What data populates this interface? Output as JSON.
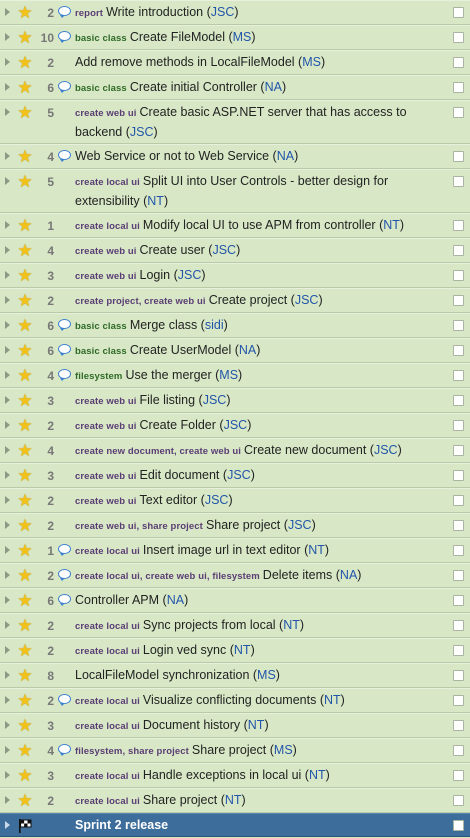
{
  "stories": [
    {
      "points": "2",
      "comment": true,
      "tags": "report",
      "tag_color": "purple",
      "title": "Write introduction",
      "owner": "JSC"
    },
    {
      "points": "10",
      "comment": true,
      "tags": "basic class",
      "tag_color": "green",
      "title": "Create FileModel",
      "owner": "MS"
    },
    {
      "points": "2",
      "comment": false,
      "tags": "",
      "tag_color": "",
      "title": "Add remove methods in LocalFileModel",
      "owner": "MS"
    },
    {
      "points": "6",
      "comment": true,
      "tags": "basic class",
      "tag_color": "green",
      "title": "Create initial Controller",
      "owner": "NA"
    },
    {
      "points": "5",
      "comment": false,
      "tags": "create web ui",
      "tag_color": "purple",
      "title": "Create basic ASP.NET server that has access to backend",
      "owner": "JSC",
      "tall": true
    },
    {
      "points": "4",
      "comment": true,
      "tags": "",
      "tag_color": "",
      "title": "Web Service or not to Web Service",
      "owner": "NA"
    },
    {
      "points": "5",
      "comment": false,
      "tags": "create local ui",
      "tag_color": "purple",
      "title": "Split UI into User Controls - better design for extensibility",
      "owner": "NT",
      "tall": true
    },
    {
      "points": "1",
      "comment": false,
      "tags": "create local ui",
      "tag_color": "purple",
      "title": "Modify local UI to use APM from controller",
      "owner": "NT"
    },
    {
      "points": "4",
      "comment": false,
      "tags": "create web ui",
      "tag_color": "purple",
      "title": "Create user",
      "owner": "JSC"
    },
    {
      "points": "3",
      "comment": false,
      "tags": "create web ui",
      "tag_color": "purple",
      "title": "Login",
      "owner": "JSC"
    },
    {
      "points": "2",
      "comment": false,
      "tags": "create project, create web ui",
      "tag_color": "purple",
      "title": "Create project",
      "owner": "JSC"
    },
    {
      "points": "6",
      "comment": true,
      "tags": "basic class",
      "tag_color": "green",
      "title": "Merge class",
      "owner": "sidi"
    },
    {
      "points": "6",
      "comment": true,
      "tags": "basic class",
      "tag_color": "green",
      "title": "Create UserModel",
      "owner": "NA"
    },
    {
      "points": "4",
      "comment": true,
      "tags": "filesystem",
      "tag_color": "green",
      "title": "Use the merger",
      "owner": "MS"
    },
    {
      "points": "3",
      "comment": false,
      "tags": "create web ui",
      "tag_color": "purple",
      "title": "File listing",
      "owner": "JSC"
    },
    {
      "points": "2",
      "comment": false,
      "tags": "create web ui",
      "tag_color": "purple",
      "title": "Create Folder",
      "owner": "JSC"
    },
    {
      "points": "4",
      "comment": false,
      "tags": "create new document, create web ui",
      "tag_color": "purple",
      "title": "Create new document",
      "owner": "JSC"
    },
    {
      "points": "3",
      "comment": false,
      "tags": "create web ui",
      "tag_color": "purple",
      "title": "Edit document",
      "owner": "JSC"
    },
    {
      "points": "2",
      "comment": false,
      "tags": "create web ui",
      "tag_color": "purple",
      "title": "Text editor",
      "owner": "JSC"
    },
    {
      "points": "2",
      "comment": false,
      "tags": "create web ui, share project",
      "tag_color": "purple",
      "title": "Share project",
      "owner": "JSC"
    },
    {
      "points": "1",
      "comment": true,
      "tags": "create local ui",
      "tag_color": "purple",
      "title": "Insert image url in text editor",
      "owner": "NT"
    },
    {
      "points": "2",
      "comment": true,
      "tags": "create local ui, create web ui, filesystem",
      "tag_color": "purple",
      "title": "Delete items",
      "owner": "NA"
    },
    {
      "points": "6",
      "comment": true,
      "tags": "",
      "tag_color": "",
      "title": "Controller APM",
      "owner": "NA"
    },
    {
      "points": "2",
      "comment": false,
      "tags": "create local ui",
      "tag_color": "purple",
      "title": "Sync projects from local",
      "owner": "NT"
    },
    {
      "points": "2",
      "comment": false,
      "tags": "create local ui",
      "tag_color": "purple",
      "title": "Login ved sync",
      "owner": "NT"
    },
    {
      "points": "8",
      "comment": false,
      "tags": "",
      "tag_color": "",
      "title": "LocalFileModel synchronization",
      "owner": "MS"
    },
    {
      "points": "2",
      "comment": true,
      "tags": "create local ui",
      "tag_color": "purple",
      "title": "Visualize conflicting documents",
      "owner": "NT"
    },
    {
      "points": "3",
      "comment": false,
      "tags": "create local ui",
      "tag_color": "purple",
      "title": "Document history",
      "owner": "NT"
    },
    {
      "points": "4",
      "comment": true,
      "tags": "filesystem, share project",
      "tag_color": "purple",
      "title": "Share project",
      "owner": "MS"
    },
    {
      "points": "3",
      "comment": false,
      "tags": "create local ui",
      "tag_color": "purple",
      "title": "Handle exceptions in local ui",
      "owner": "NT"
    },
    {
      "points": "2",
      "comment": false,
      "tags": "create local ui",
      "tag_color": "purple",
      "title": "Share project",
      "owner": "NT"
    }
  ],
  "sprint": {
    "label": "Sprint 2 release"
  },
  "colors": {
    "row_bg": "#d8e8c6",
    "star": "#f2c21b",
    "tag_purple": "#5a3d74",
    "tag_green": "#2f6a27",
    "owner": "#2255aa",
    "sprint_bg": "#3d6d9a"
  },
  "icons": {
    "star": "star-icon",
    "comment": "comment-bubble-icon",
    "expand": "expand-triangle-icon",
    "flag": "flag-icon"
  }
}
